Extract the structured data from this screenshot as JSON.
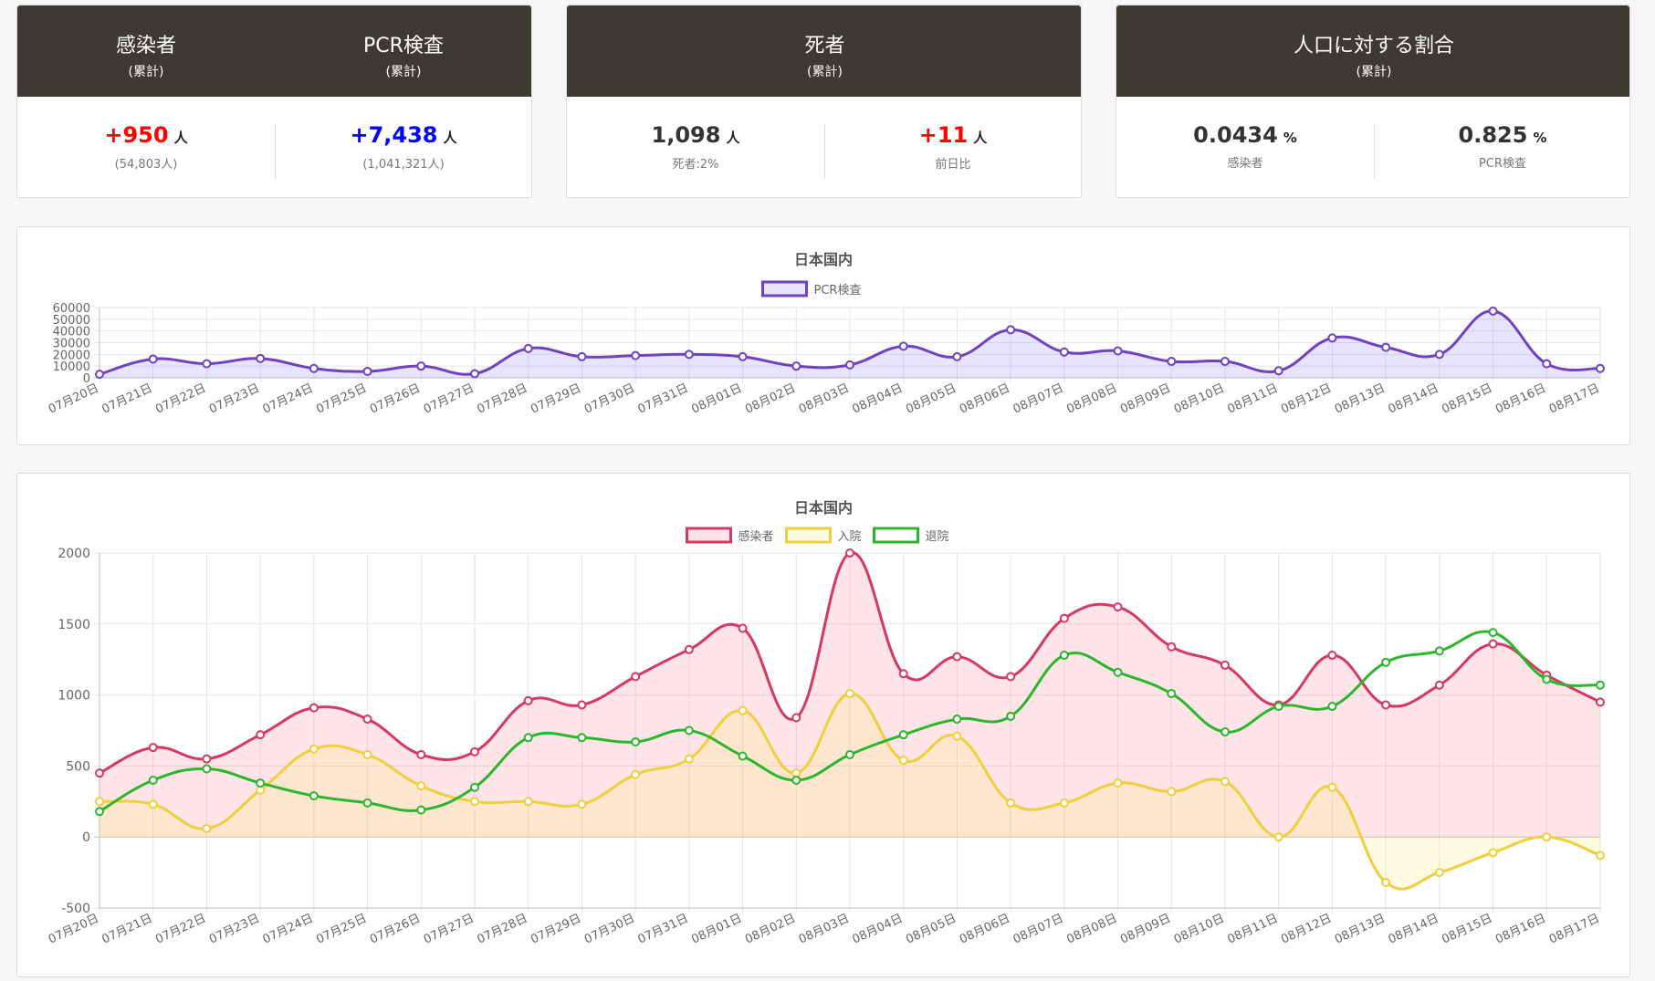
{
  "stats": [
    {
      "columns": [
        {
          "title": "感染者",
          "subtitle": "(累計)",
          "value": "+950",
          "unit": "人",
          "sub": "(54,803人)",
          "color": "#ff0000"
        },
        {
          "title": "PCR検査",
          "subtitle": "(累計)",
          "value": "+7,438",
          "unit": "人",
          "sub": "(1,041,321人)",
          "color": "#0000ff"
        }
      ]
    },
    {
      "title": "死者",
      "subtitle": "(累計)",
      "columns": [
        {
          "value": "1,098",
          "unit": "人",
          "sub": "死者:2%",
          "color": "#333333"
        },
        {
          "value": "+11",
          "unit": "人",
          "sub": "前日比",
          "color": "#ff0000"
        }
      ]
    },
    {
      "title": "人口に対する割合",
      "subtitle": "(累計)",
      "columns": [
        {
          "value": "0.0434",
          "unit": "%",
          "sub": "感染者",
          "color": "#333333"
        },
        {
          "value": "0.825",
          "unit": "%",
          "sub": "PCR検査",
          "color": "#333333"
        }
      ]
    }
  ],
  "chart_data": [
    {
      "type": "area",
      "title": "日本国内",
      "categories": [
        "07月20日",
        "07月21日",
        "07月22日",
        "07月23日",
        "07月24日",
        "07月25日",
        "07月26日",
        "07月27日",
        "07月28日",
        "07月29日",
        "07月30日",
        "07月31日",
        "08月01日",
        "08月02日",
        "08月03日",
        "08月04日",
        "08月05日",
        "08月06日",
        "08月07日",
        "08月08日",
        "08月09日",
        "08月10日",
        "08月11日",
        "08月12日",
        "08月13日",
        "08月14日",
        "08月15日",
        "08月16日",
        "08月17日"
      ],
      "ylim": [
        0,
        60000
      ],
      "yticks": [
        0,
        10000,
        20000,
        30000,
        40000,
        50000,
        60000
      ],
      "grid": true,
      "legend": "top",
      "series": [
        {
          "name": "PCR検査",
          "color": "#6f42c1",
          "fill": "rgba(140,130,255,0.22)",
          "values": [
            3000,
            16000,
            12000,
            16500,
            8000,
            5500,
            10000,
            3500,
            25000,
            18000,
            19000,
            20000,
            18000,
            10000,
            11000,
            27000,
            18000,
            41000,
            22000,
            23000,
            14000,
            14000,
            6000,
            34000,
            26000,
            20000,
            57000,
            12000,
            8000
          ]
        }
      ]
    },
    {
      "type": "area",
      "title": "日本国内",
      "categories": [
        "07月20日",
        "07月21日",
        "07月22日",
        "07月23日",
        "07月24日",
        "07月25日",
        "07月26日",
        "07月27日",
        "07月28日",
        "07月29日",
        "07月30日",
        "07月31日",
        "08月01日",
        "08月02日",
        "08月03日",
        "08月04日",
        "08月05日",
        "08月06日",
        "08月07日",
        "08月08日",
        "08月09日",
        "08月10日",
        "08月11日",
        "08月12日",
        "08月13日",
        "08月14日",
        "08月15日",
        "08月16日",
        "08月17日"
      ],
      "ylim": [
        -500,
        2000
      ],
      "yticks": [
        -500,
        0,
        500,
        1000,
        1500,
        2000
      ],
      "grid": true,
      "legend": "top",
      "series": [
        {
          "name": "感染者",
          "color": "#d63864",
          "fill": "rgba(255,120,140,0.2)",
          "values": [
            450,
            630,
            550,
            720,
            910,
            830,
            580,
            600,
            960,
            930,
            1130,
            1320,
            1470,
            840,
            2000,
            1150,
            1270,
            1130,
            1540,
            1620,
            1340,
            1210,
            930,
            1280,
            930,
            1070,
            1360,
            1140,
            950
          ]
        },
        {
          "name": "入院",
          "color": "#f0cf3c",
          "fill": "rgba(255,235,120,0.22)",
          "values": [
            250,
            230,
            60,
            330,
            620,
            580,
            360,
            250,
            250,
            230,
            440,
            550,
            890,
            450,
            1010,
            540,
            710,
            240,
            240,
            380,
            320,
            390,
            0,
            350,
            -320,
            -250,
            -110,
            0,
            -130
          ]
        },
        {
          "name": "退院",
          "color": "#2db52d",
          "fill": "none",
          "values": [
            180,
            400,
            480,
            380,
            290,
            240,
            190,
            350,
            700,
            700,
            670,
            750,
            570,
            400,
            580,
            720,
            830,
            850,
            1280,
            1160,
            1010,
            740,
            920,
            920,
            1230,
            1310,
            1440,
            1110,
            1070
          ]
        }
      ]
    }
  ]
}
